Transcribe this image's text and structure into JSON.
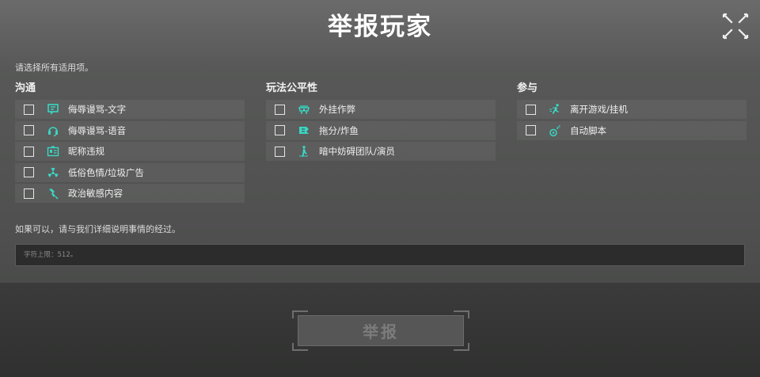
{
  "title": "举报玩家",
  "instruction": "请选择所有适用项。",
  "sections": [
    {
      "title": "沟通",
      "options": [
        {
          "label": "侮辱谩骂-文字",
          "icon": "chat-text-icon"
        },
        {
          "label": "侮辱谩骂-语音",
          "icon": "headset-icon"
        },
        {
          "label": "昵称违规",
          "icon": "id-card-icon"
        },
        {
          "label": "低俗色情/垃圾广告",
          "icon": "radiation-icon"
        },
        {
          "label": "政治敏感内容",
          "icon": "hand-icon"
        }
      ]
    },
    {
      "title": "玩法公平性",
      "options": [
        {
          "label": "外挂作弊",
          "icon": "goggles-icon"
        },
        {
          "label": "拖分/炸鱼",
          "icon": "flag-icon"
        },
        {
          "label": "暗中妨碍团队/演员",
          "icon": "sneak-icon"
        }
      ]
    },
    {
      "title": "参与",
      "options": [
        {
          "label": "离开游戏/挂机",
          "icon": "running-icon"
        },
        {
          "label": "自动脚本",
          "icon": "sleeping-icon"
        }
      ]
    }
  ],
  "detail_prompt": "如果可以，请与我们详细说明事情的经过。",
  "detail_placeholder": "字符上限：512。",
  "submit_label": "举报",
  "colors": {
    "icon_accent": "#3ad6c4",
    "checkbox_border": "#e6e6e6",
    "button_text_disabled": "#7b7c7b"
  }
}
